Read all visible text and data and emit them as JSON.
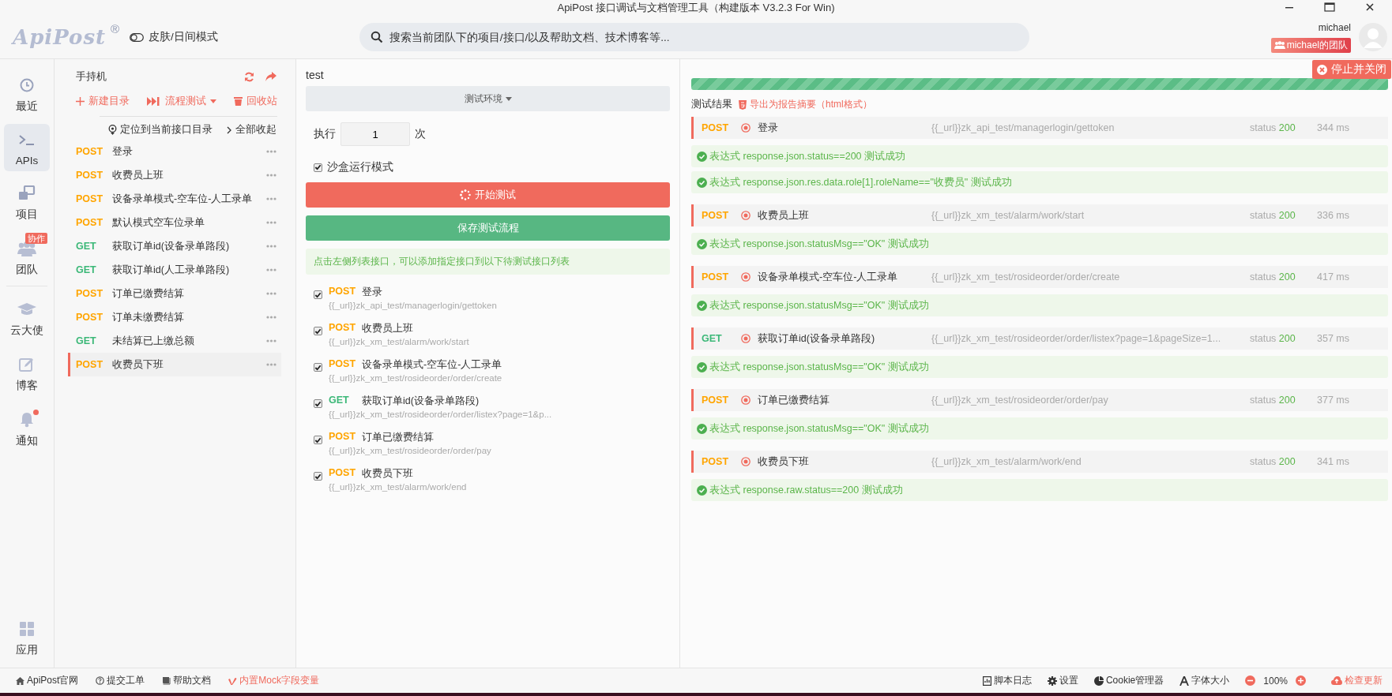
{
  "window": {
    "title": "ApiPost 接口调试与文档管理工具（构建版本 V3.2.3 For Win)"
  },
  "header": {
    "logo": "ApiPost",
    "logo_mark": "®",
    "theme_toggle": "皮肤/日间模式",
    "search": {
      "placeholder": "搜索当前团队下的项目/接口/以及帮助文档、技术博客等..."
    },
    "user": {
      "name": "michael",
      "team": "michael的团队"
    }
  },
  "nav": [
    {
      "kind": "clock",
      "label": "最近",
      "selected": false
    },
    {
      "kind": "terminal",
      "label": "APIs",
      "selected": true
    },
    {
      "kind": "project",
      "label": "项目",
      "selected": false
    },
    {
      "kind": "team",
      "label": "团队",
      "selected": false,
      "badge": "协作"
    },
    {
      "kind": "cap",
      "label": "云大使",
      "selected": false
    },
    {
      "kind": "edit",
      "label": "博客",
      "selected": false
    },
    {
      "kind": "bell",
      "label": "通知",
      "selected": false,
      "dot": true
    }
  ],
  "nav_bottom": {
    "kind": "apps",
    "label": "应用"
  },
  "sidebar": {
    "title": "手持机",
    "actions": [
      {
        "kind": "plus",
        "label": "新建目录"
      },
      {
        "kind": "flow",
        "label": "流程测试"
      },
      {
        "kind": "trash",
        "label": "回收站"
      }
    ],
    "locate": "定位到当前接口目录",
    "collapse": "全部收起",
    "items": [
      {
        "method": "POST",
        "color": "#ffa500",
        "name": "登录",
        "selected": false
      },
      {
        "method": "POST",
        "color": "#ffa500",
        "name": "收费员上班",
        "selected": false
      },
      {
        "method": "POST",
        "color": "#ffa500",
        "name": "设备录单模式-空车位-人工录单",
        "selected": false
      },
      {
        "method": "POST",
        "color": "#ffa500",
        "name": "默认模式空车位录单",
        "selected": false
      },
      {
        "method": "GET",
        "color": "#3cb878",
        "name": "获取订单id(设备录单路段)",
        "selected": false
      },
      {
        "method": "GET",
        "color": "#3cb878",
        "name": "获取订单id(人工录单路段)",
        "selected": false
      },
      {
        "method": "POST",
        "color": "#ffa500",
        "name": "订单已缴费结算",
        "selected": false
      },
      {
        "method": "POST",
        "color": "#ffa500",
        "name": "订单未缴费结算",
        "selected": false
      },
      {
        "method": "GET",
        "color": "#3cb878",
        "name": "未结算已上缴总额",
        "selected": false
      },
      {
        "method": "POST",
        "color": "#ffa500",
        "name": "收费员下班",
        "selected": true
      }
    ]
  },
  "flow": {
    "name": "test",
    "environment": "测试环境",
    "runs_label": "执行",
    "runs": "1",
    "runs_unit": "次",
    "sandbox": {
      "label": "沙盒运行模式",
      "checked": true
    },
    "start": "开始测试",
    "save": "保存测试流程",
    "hint": "点击左侧列表接口，可以添加指定接口到以下待测试接口列表",
    "steps": [
      {
        "checked": true,
        "method": "POST",
        "color": "#ffa500",
        "name": "登录",
        "url": "{{_url}}zk_api_test/managerlogin/gettoken"
      },
      {
        "checked": true,
        "method": "POST",
        "color": "#ffa500",
        "name": "收费员上班",
        "url": "{{_url}}zk_xm_test/alarm/work/start"
      },
      {
        "checked": true,
        "method": "POST",
        "color": "#ffa500",
        "name": "设备录单模式-空车位-人工录单",
        "url": "{{_url}}zk_xm_test/rosideorder/order/create"
      },
      {
        "checked": true,
        "method": "GET",
        "color": "#3cb878",
        "name": "获取订单id(设备录单路段)",
        "url": "{{_url}}zk_xm_test/rosideorder/order/listex?page=1&p..."
      },
      {
        "checked": true,
        "method": "POST",
        "color": "#ffa500",
        "name": "订单已缴费结算",
        "url": "{{_url}}zk_xm_test/rosideorder/order/pay"
      },
      {
        "checked": true,
        "method": "POST",
        "color": "#ffa500",
        "name": "收费员下班",
        "url": "{{_url}}zk_xm_test/alarm/work/end"
      }
    ]
  },
  "results": {
    "level": 1,
    "stop": "停止并关闭",
    "title": "测试结果",
    "export": "导出为报告摘要（html格式）",
    "items": [
      {
        "method": "POST",
        "color": "#ffa500",
        "name": "登录",
        "url": "{{_url}}zk_api_test/managerlogin/gettoken",
        "status_label": "status",
        "status": "200",
        "time": "344 ms",
        "assertions": [
          "表达式 response.json.status==200 测试成功",
          "表达式 response.json.res.data.role[1].roleName==\"收费员\" 测试成功"
        ]
      },
      {
        "method": "POST",
        "color": "#ffa500",
        "name": "收费员上班",
        "url": "{{_url}}zk_xm_test/alarm/work/start",
        "status_label": "status",
        "status": "200",
        "time": "336 ms",
        "assertions": [
          "表达式 response.json.statusMsg==\"OK\" 测试成功"
        ]
      },
      {
        "method": "POST",
        "color": "#ffa500",
        "name": "设备录单模式-空车位-人工录单",
        "url": "{{_url}}zk_xm_test/rosideorder/order/create",
        "status_label": "status",
        "status": "200",
        "time": "417 ms",
        "assertions": [
          "表达式 response.json.statusMsg==\"OK\" 测试成功"
        ]
      },
      {
        "method": "GET",
        "color": "#3cb878",
        "name": "获取订单id(设备录单路段)",
        "url": "{{_url}}zk_xm_test/rosideorder/order/listex?page=1&pageSize=1...",
        "status_label": "status",
        "status": "200",
        "time": "357 ms",
        "assertions": [
          "表达式 response.json.statusMsg==\"OK\" 测试成功"
        ]
      },
      {
        "method": "POST",
        "color": "#ffa500",
        "name": "订单已缴费结算",
        "url": "{{_url}}zk_xm_test/rosideorder/order/pay",
        "status_label": "status",
        "status": "200",
        "time": "377 ms",
        "assertions": [
          "表达式 response.json.statusMsg==\"OK\" 测试成功"
        ]
      },
      {
        "method": "POST",
        "color": "#ffa500",
        "name": "收费员下班",
        "url": "{{_url}}zk_xm_test/alarm/work/end",
        "status_label": "status",
        "status": "200",
        "time": "341 ms",
        "assertions": [
          "表达式 response.raw.status==200 测试成功"
        ]
      }
    ]
  },
  "footer": {
    "links": [
      {
        "kind": "home",
        "label": "ApiPost官网",
        "accent": false
      },
      {
        "kind": "help",
        "label": "提交工单",
        "accent": false
      },
      {
        "kind": "book",
        "label": "帮助文档",
        "accent": false
      },
      {
        "kind": "vimeo",
        "label": "内置Mock字段变量",
        "accent": true
      }
    ],
    "tools": [
      {
        "kind": "log",
        "label": "脚本日志"
      },
      {
        "kind": "gear",
        "label": "设置"
      },
      {
        "kind": "pie",
        "label": "Cookie管理器"
      },
      {
        "kind": "font",
        "label": "字体大小"
      }
    ],
    "zoom": "100%",
    "update": "检查更新"
  }
}
